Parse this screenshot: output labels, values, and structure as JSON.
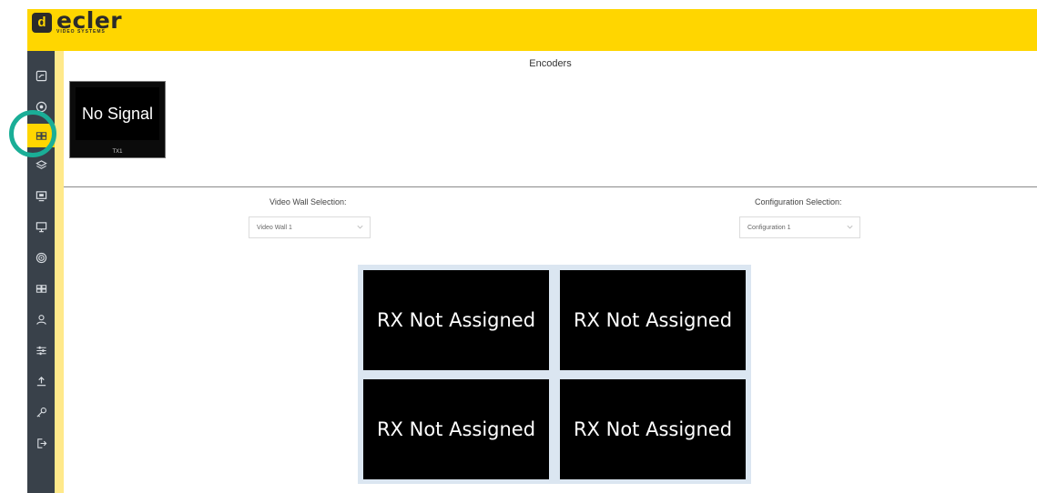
{
  "brand": {
    "mark": "d",
    "name": "ecler",
    "subtitle": "VIDEO SYSTEMS"
  },
  "colors": {
    "topbar": "#FFD600",
    "sidebar": "#39414a",
    "sidebar_active": "#FFD600",
    "highlight_ring": "#1aae97",
    "wall_background": "#dbe6f1"
  },
  "sidebar": {
    "items": [
      {
        "icon": "dashboard-icon",
        "active": false
      },
      {
        "icon": "network-icon",
        "active": false
      },
      {
        "icon": "grid-icon",
        "active": true
      },
      {
        "icon": "layers-icon",
        "active": false
      },
      {
        "icon": "display-icon",
        "active": false
      },
      {
        "icon": "monitor-icon",
        "active": false
      },
      {
        "icon": "signal-icon",
        "active": false
      },
      {
        "icon": "matrix-icon",
        "active": false
      },
      {
        "icon": "user-icon",
        "active": false
      },
      {
        "icon": "sliders-icon",
        "active": false
      },
      {
        "icon": "upload-icon",
        "active": false
      },
      {
        "icon": "key-icon",
        "active": false
      },
      {
        "icon": "logout-icon",
        "active": false
      }
    ]
  },
  "encoders": {
    "title": "Encoders",
    "items": [
      {
        "screen_text": "No Signal",
        "label": "TX1"
      }
    ]
  },
  "video_wall_selection": {
    "label": "Video Wall Selection:",
    "value": "Video Wall 1"
  },
  "configuration_selection": {
    "label": "Configuration Selection:",
    "value": "Configuration 1"
  },
  "video_wall": {
    "cells": [
      {
        "text": "RX Not Assigned"
      },
      {
        "text": "RX Not Assigned"
      },
      {
        "text": "RX Not Assigned"
      },
      {
        "text": "RX Not Assigned"
      }
    ]
  }
}
